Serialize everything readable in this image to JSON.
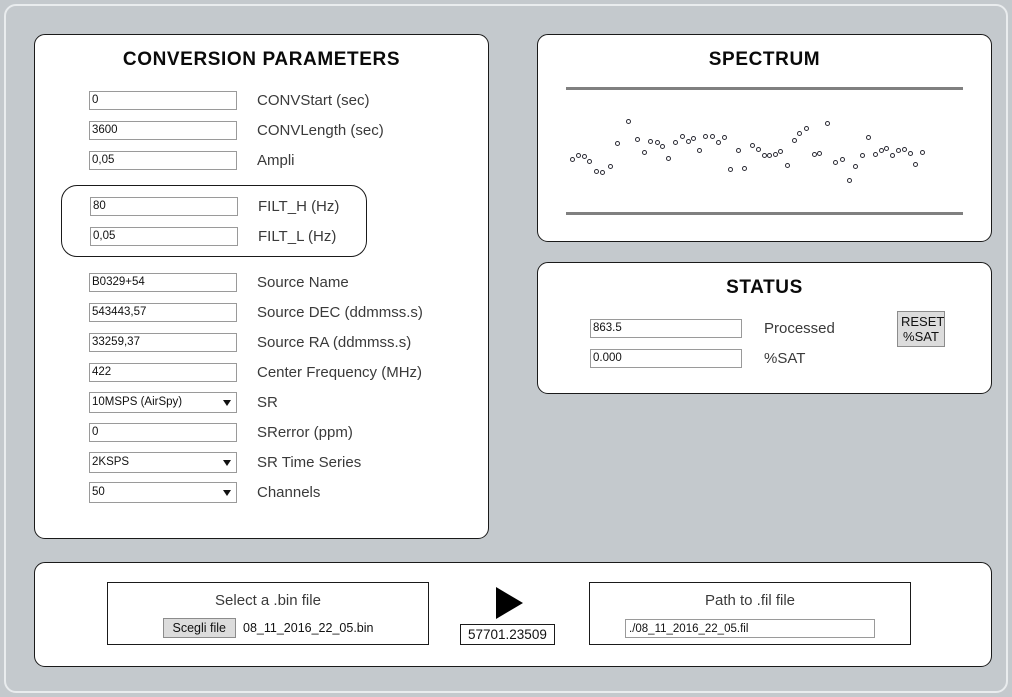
{
  "conversion": {
    "title": "CONVERSION PARAMETERS",
    "fields": [
      {
        "value": "0",
        "label": "CONVStart (sec)"
      },
      {
        "value": "3600",
        "label": "CONVLength (sec)"
      },
      {
        "value": "0,05",
        "label": "Ampli"
      }
    ],
    "filter_group": [
      {
        "value": "80",
        "label": "FILT_H (Hz)"
      },
      {
        "value": "0,05",
        "label": "FILT_L (Hz)"
      }
    ],
    "source_fields": [
      {
        "value": "B0329+54",
        "label": "Source Name",
        "type": "text"
      },
      {
        "value": "543443,57",
        "label": "Source DEC (ddmmss.s)",
        "type": "text"
      },
      {
        "value": "33259,37",
        "label": "Source RA (ddmmss.s)",
        "type": "text"
      },
      {
        "value": "422",
        "label": "Center Frequency (MHz)",
        "type": "text"
      },
      {
        "value": "10MSPS (AirSpy)",
        "label": "SR",
        "type": "select"
      },
      {
        "value": "0",
        "label": "SRerror (ppm)",
        "type": "text"
      },
      {
        "value": "2KSPS",
        "label": "SR Time Series",
        "type": "select"
      },
      {
        "value": "50",
        "label": "Channels",
        "type": "select"
      }
    ]
  },
  "spectrum": {
    "title": "SPECTRUM"
  },
  "status": {
    "title": "STATUS",
    "rows": [
      {
        "value": "863.5",
        "label": "Processed"
      },
      {
        "value": "0.000",
        "label": "%SAT"
      }
    ],
    "reset_button": "RESET %SAT"
  },
  "bottom": {
    "bin_title": "Select a .bin file",
    "choose_file_label": "Scegli file",
    "bin_file_name": "08_11_2016_22_05.bin",
    "mjd": "57701.23509",
    "fil_title": "Path to .fil file",
    "fil_path": "./08_11_2016_22_05.fil"
  },
  "chart_data": {
    "type": "scatter",
    "title": "SPECTRUM",
    "xlabel": "",
    "ylabel": "",
    "grid": false,
    "legend": null,
    "xlim": [
      0,
      100
    ],
    "ylim": [
      0,
      100
    ],
    "marker": "open-circle",
    "points": [
      [
        1.0,
        40.0
      ],
      [
        2.6,
        44.0
      ],
      [
        4.0,
        43.0
      ],
      [
        5.2,
        38.0
      ],
      [
        7.0,
        28.0
      ],
      [
        8.6,
        27.0
      ],
      [
        10.6,
        33.5
      ],
      [
        12.4,
        56.0
      ],
      [
        15.0,
        78.0
      ],
      [
        17.2,
        60.5
      ],
      [
        19.0,
        47.0
      ],
      [
        20.6,
        58.5
      ],
      [
        22.2,
        57.0
      ],
      [
        23.6,
        53.0
      ],
      [
        25.0,
        41.0
      ],
      [
        26.8,
        57.0
      ],
      [
        28.6,
        63.5
      ],
      [
        30.0,
        58.0
      ],
      [
        31.4,
        61.0
      ],
      [
        32.8,
        49.0
      ],
      [
        34.4,
        63.5
      ],
      [
        36.0,
        63.0
      ],
      [
        37.6,
        57.5
      ],
      [
        39.0,
        62.0
      ],
      [
        40.6,
        30.0
      ],
      [
        42.6,
        49.0
      ],
      [
        44.2,
        31.0
      ],
      [
        46.0,
        54.0
      ],
      [
        47.6,
        50.0
      ],
      [
        49.0,
        44.5
      ],
      [
        50.4,
        44.5
      ],
      [
        51.8,
        45.0
      ],
      [
        53.2,
        48.5
      ],
      [
        55.0,
        34.0
      ],
      [
        56.6,
        59.5
      ],
      [
        58.0,
        66.0
      ],
      [
        59.6,
        71.0
      ],
      [
        61.6,
        45.0
      ],
      [
        63.0,
        46.0
      ],
      [
        65.0,
        76.0
      ],
      [
        67.0,
        37.0
      ],
      [
        68.6,
        40.5
      ],
      [
        70.4,
        19.0
      ],
      [
        72.0,
        33.0
      ],
      [
        73.6,
        44.5
      ],
      [
        75.2,
        62.0
      ],
      [
        77.0,
        45.5
      ],
      [
        78.4,
        49.0
      ],
      [
        79.8,
        51.5
      ],
      [
        81.2,
        44.5
      ],
      [
        82.6,
        49.5
      ],
      [
        84.2,
        50.0
      ],
      [
        85.6,
        46.5
      ],
      [
        87.0,
        35.0
      ],
      [
        88.6,
        47.0
      ]
    ]
  }
}
